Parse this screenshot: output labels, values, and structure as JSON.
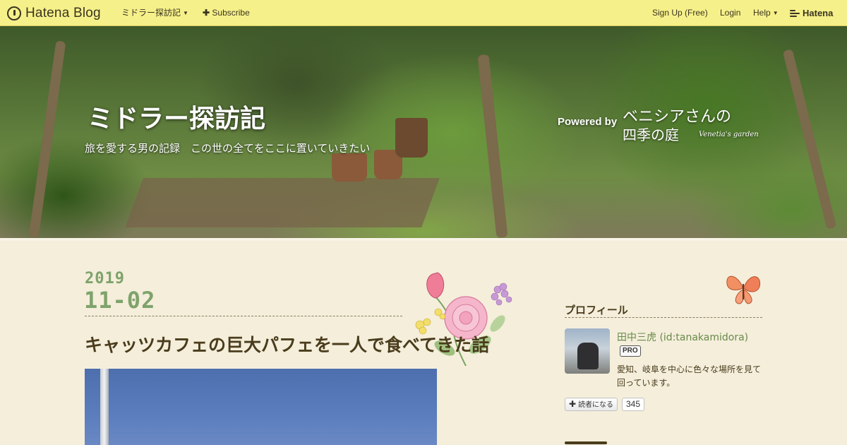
{
  "topbar": {
    "brand": "Hatena Blog",
    "blog_menu": "ミドラー探訪記",
    "subscribe": "Subscribe",
    "signup": "Sign Up (Free)",
    "login": "Login",
    "help": "Help",
    "hatena": "Hatena"
  },
  "header": {
    "title": "ミドラー探訪記",
    "description": "旅を愛する男の記録　この世の全てをここに置いていきたい",
    "powered_by": "Powered by",
    "theme_line1": "ベニシアさんの",
    "theme_line2": "四季の庭",
    "theme_script": "Venetia's garden"
  },
  "entry": {
    "year": "2019",
    "month_day": "11-02",
    "title": "キャッツカフェの巨大パフェを一人で食べてきた話"
  },
  "sidebar": {
    "profile_heading": "プロフィール",
    "profile_name": "田中三虎 (id:tanakamidora)",
    "pro_badge": "PRO",
    "profile_desc": "愛知、岐阜を中心に色々な場所を見て回っています。",
    "subscribe_label": "読者になる",
    "subscriber_count": "345"
  },
  "colors": {
    "topbar_bg": "#f6f08a",
    "page_bg": "#f4eedb",
    "date_green": "#7fa36b",
    "title_brown": "#4a3c1c",
    "link_green": "#6a8a4a"
  }
}
